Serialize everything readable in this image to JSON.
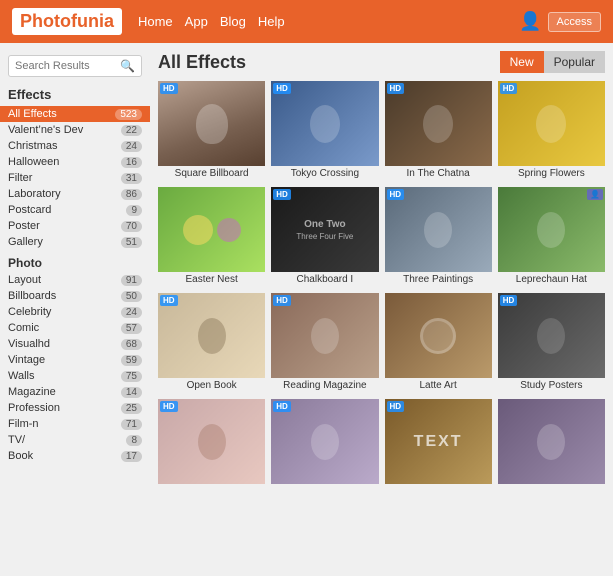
{
  "header": {
    "logo": "Photofunia",
    "nav": [
      "Home",
      "App",
      "Blog",
      "Help"
    ],
    "access_label": "Access"
  },
  "sidebar": {
    "search_placeholder": "Search Results",
    "effects_label": "Effects",
    "items_effects": [
      {
        "label": "All Effects",
        "count": "523",
        "active": true
      },
      {
        "label": "Valent’ne's Dev",
        "count": "22"
      },
      {
        "label": "Christmas",
        "count": "24"
      },
      {
        "label": "Halloween",
        "count": "16"
      },
      {
        "label": "Filter",
        "count": "31"
      },
      {
        "label": "Laboratory",
        "count": "86"
      },
      {
        "label": "Postcard",
        "count": "9"
      },
      {
        "label": "Poster",
        "count": "70"
      },
      {
        "label": "Gallery",
        "count": "51"
      }
    ],
    "photo_label": "Photo",
    "items_photo": [
      {
        "label": "Layout",
        "count": "91"
      },
      {
        "label": "Billboards",
        "count": "50"
      },
      {
        "label": "Celebrity",
        "count": "24"
      },
      {
        "label": "Comic",
        "count": "57"
      },
      {
        "label": "Visualhd",
        "count": "68"
      },
      {
        "label": "Vintage",
        "count": "59"
      },
      {
        "label": "Walls",
        "count": "75"
      },
      {
        "label": "Magazine",
        "count": "14"
      },
      {
        "label": "Profession",
        "count": "25"
      },
      {
        "label": "Film-n",
        "count": "71"
      },
      {
        "label": "TV/",
        "count": "8"
      },
      {
        "label": "Book",
        "count": "17"
      }
    ]
  },
  "content": {
    "title": "All Effects",
    "tabs": [
      "New",
      "Popular"
    ],
    "active_tab": "New",
    "effects": [
      {
        "label": "Square Billboard",
        "hd": true,
        "bg": "street"
      },
      {
        "label": "Tokyo Crossing",
        "hd": true,
        "bg": "city"
      },
      {
        "label": "In The Chatna",
        "hd": true,
        "bg": "chat"
      },
      {
        "label": "Spring Flowers",
        "hd": true,
        "bg": "flowers"
      },
      {
        "label": "Easter Nest",
        "hd": false,
        "bg": "easter"
      },
      {
        "label": "Chalkboard I",
        "hd": true,
        "bg": "chalk"
      },
      {
        "label": "Three Paintings",
        "hd": true,
        "bg": "paintings"
      },
      {
        "label": "Leprechaun Hat",
        "hd": false,
        "pro": true,
        "bg": "leprechaun"
      },
      {
        "label": "Open Book",
        "hd": true,
        "bg": "book"
      },
      {
        "label": "Reading Magazine",
        "hd": true,
        "bg": "magazine"
      },
      {
        "label": "Latte Art",
        "hd": false,
        "bg": "latte"
      },
      {
        "label": "Study Posters",
        "hd": true,
        "bg": "poster"
      },
      {
        "label": "",
        "hd": true,
        "bg": "vintage1"
      },
      {
        "label": "",
        "hd": true,
        "bg": "photos"
      },
      {
        "label": "",
        "hd": true,
        "bg": "text"
      },
      {
        "label": "",
        "hd": false,
        "bg": "woman"
      }
    ]
  }
}
